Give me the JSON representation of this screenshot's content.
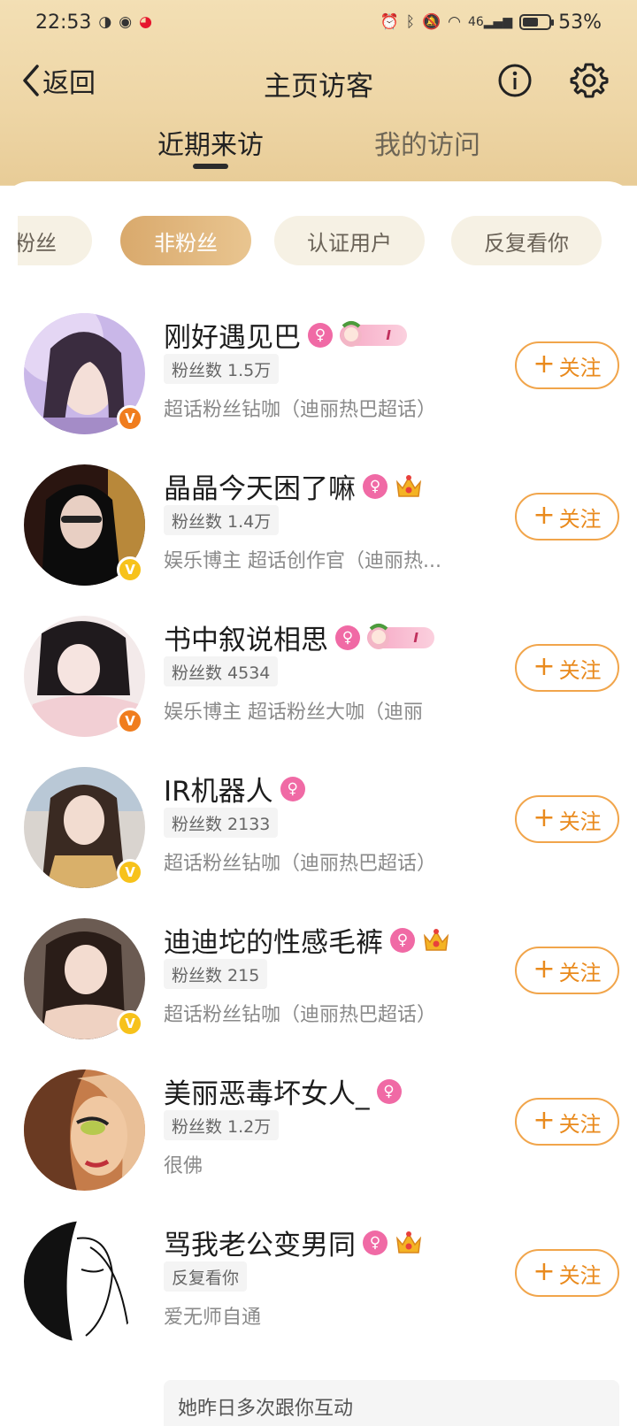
{
  "status": {
    "time": "22:53",
    "network": "46",
    "battery_text": "53%",
    "battery_level": 0.53
  },
  "nav": {
    "back_label": "返回",
    "title": "主页访客"
  },
  "tabs": [
    {
      "label": "近期来访",
      "active": true
    },
    {
      "label": "我的访问",
      "active": false
    }
  ],
  "chips": [
    {
      "label": "粉丝",
      "active": false
    },
    {
      "label": "非粉丝",
      "active": true
    },
    {
      "label": "认证用户",
      "active": false
    },
    {
      "label": "反复看你",
      "active": false
    }
  ],
  "follow_label": "关注",
  "users": [
    {
      "name": "刚好遇见巴",
      "tag": "粉丝数 1.5万",
      "desc": "超话粉丝钻咖（迪丽热巴超话）",
      "verified": "orange",
      "badge": "level",
      "level_text": "I"
    },
    {
      "name": "晶晶今天困了嘛",
      "tag": "粉丝数 1.4万",
      "desc": "娱乐博主 超话创作官（迪丽热...",
      "verified": "yellow",
      "badge": "crown"
    },
    {
      "name": "书中叙说相思",
      "tag": "粉丝数 4534",
      "desc": "娱乐博主 超话粉丝大咖（迪丽",
      "verified": "orange",
      "badge": "level",
      "level_text": "I"
    },
    {
      "name": "IR机器人",
      "tag": "粉丝数 2133",
      "desc": "超话粉丝钻咖（迪丽热巴超话）",
      "verified": "yellow",
      "badge": "none"
    },
    {
      "name": "迪迪坨的性感毛裤",
      "tag": "粉丝数 215",
      "desc": "超话粉丝钻咖（迪丽热巴超话）",
      "verified": "yellow",
      "badge": "crown"
    },
    {
      "name": "美丽恶毒坏女人_",
      "tag": "粉丝数 1.2万",
      "desc": "很佛",
      "verified": "none",
      "badge": "none"
    },
    {
      "name": "骂我老公变男同",
      "tag": "反复看你",
      "desc": "爱无师自通",
      "verified": "none",
      "badge": "crown"
    }
  ],
  "hint": "她昨日多次跟你互动",
  "colors": {
    "accent": "#e98a1d",
    "chip_active": "#dcae72",
    "female": "#f06aa5"
  }
}
